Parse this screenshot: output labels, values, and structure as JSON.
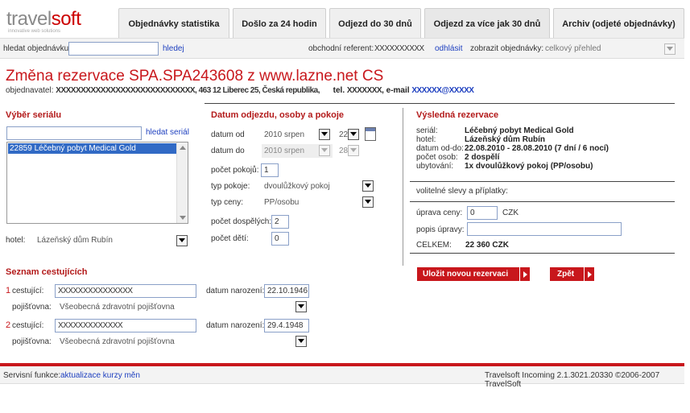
{
  "logo": {
    "name_a": "travel",
    "name_b": "soft",
    "tagline": "innovative web solutions"
  },
  "tabs": [
    "Objednávky statistika",
    "Došlo za 24 hodin",
    "Odjezd do 30 dnů",
    "Odjezd za více jak 30 dnů",
    "Archiv (odjeté objednávky)"
  ],
  "topbar": {
    "search_label": "hledat objednávku:",
    "search_value": "",
    "search_link": "hledej",
    "referent_label": "obchodní referent:",
    "referent_value": "XXXXXXXXXX",
    "logout_link": "odhlásit",
    "view_label": "zobrazit objednávky:",
    "view_value": "celkový přehled"
  },
  "heading": {
    "title": "Změna rezervace SPA.SPA243608 z www.lazne.net CS",
    "customer_label": "objednavatel:",
    "customer_value": "XXXXXXXXXXXXXXXXXXXXXXXXXXXX, 463 12 Liberec 25, Česká republika,",
    "tel_label": "tel.",
    "tel_value": "XXXXXXX",
    "email_label": ", e-mail",
    "email_value": "XXXXXX@XXXXX"
  },
  "serial": {
    "title": "Výběr seriálu",
    "search_value": "",
    "search_link": "hledat seriál",
    "list_item": "22859 Léčebný pobyt Medical Gold",
    "hotel_label": "hotel:",
    "hotel_value": "Lázeňský dům Rubín"
  },
  "departure": {
    "title": "Datum odjezdu, osoby a pokoje",
    "from_label": "datum od",
    "from_month": "2010 srpen",
    "from_day": "22",
    "to_label": "datum do",
    "to_month": "2010 srpen",
    "to_day": "28",
    "rooms_label": "počet pokojů:",
    "rooms_value": "1",
    "room_type_label": "typ pokoje:",
    "room_type_value": "dvoulůžkový pokoj",
    "price_type_label": "typ ceny:",
    "price_type_value": "PP/osobu",
    "adults_label": "počet dospělých:",
    "adults_value": "2",
    "children_label": "počet dětí:",
    "children_value": "0"
  },
  "result": {
    "title": "Výsledná rezervace",
    "rows": [
      {
        "label": "seriál:",
        "value": "Léčebný pobyt Medical Gold"
      },
      {
        "label": "hotel:",
        "value": "Lázeňský dům Rubín"
      },
      {
        "label": "datum od-do:",
        "value": "22.08.2010 - 28.08.2010 (7 dní / 6 nocí)"
      },
      {
        "label": "počet osob:",
        "value": "2 dospělí"
      },
      {
        "label": "ubytování:",
        "value": "1x dvoulůžkový pokoj (PP/osobu)"
      }
    ],
    "discounts_label": "volitelné slevy a příplatky:",
    "price_adj_label": "úprava ceny:",
    "price_adj_value": "0",
    "currency": "CZK",
    "adj_desc_label": "popis úpravy:",
    "adj_desc_value": "",
    "total_label": "CELKEM:",
    "total_value": "22 360 CZK",
    "save_button": "Uložit novou rezervaci",
    "back_button": "Zpět"
  },
  "travellers": {
    "title": "Seznam cestujících",
    "items": [
      {
        "index": "1",
        "label": "cestující:",
        "name": "XXXXXXXXXXXXXXX",
        "dob_label": "datum narození:",
        "dob": "22.10.1946",
        "ins_label": "pojišťovna:",
        "ins": "Všeobecná zdravotní pojišťovna"
      },
      {
        "index": "2",
        "label": "cestující:",
        "name": "XXXXXXXXXXXXX",
        "dob_label": "datum narození:",
        "dob": "29.4.1948",
        "ins_label": "pojišťovna:",
        "ins": "Všeobecná zdravotní pojišťovna"
      }
    ]
  },
  "footer": {
    "service_label": "Servisní funkce:",
    "service_link": "aktualizace kurzy měn",
    "version": "Travelsoft Incoming 2.1.3021.20330 ©2006-2007 TravelSoft"
  },
  "colors": {
    "accent": "#c8171c",
    "link": "#1d3fbf"
  }
}
